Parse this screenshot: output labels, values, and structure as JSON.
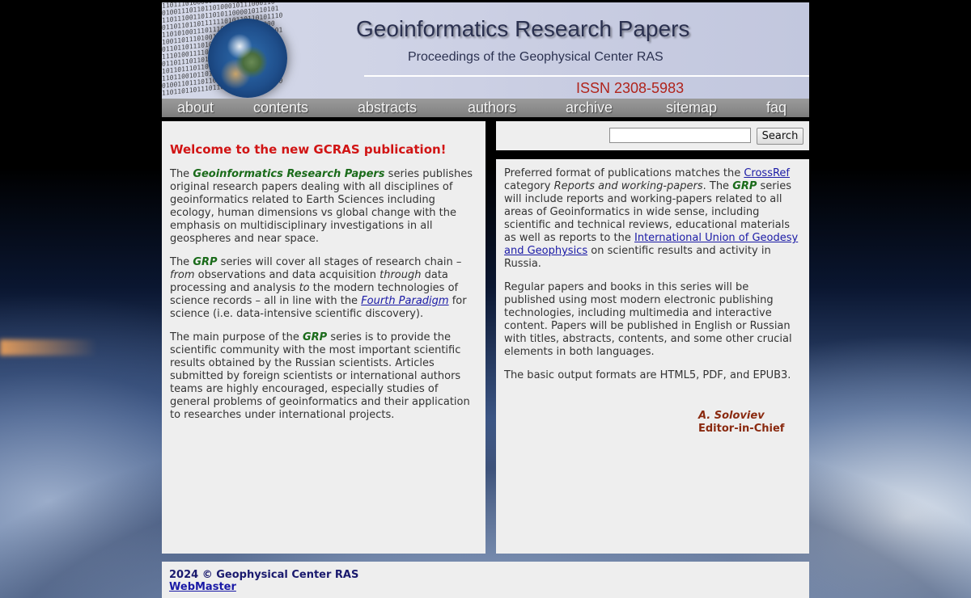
{
  "header": {
    "title": "Geoinformatics Research Papers",
    "subtitle": "Proceedings of the Geophysical Center RAS",
    "issn": "ISSN 2308-5983"
  },
  "nav": {
    "about": "about",
    "contents": "contents",
    "abstracts": "abstracts",
    "authors": "authors",
    "archive": "archive",
    "sitemap": "sitemap",
    "faq": "faq"
  },
  "search": {
    "value": "",
    "button": "Search"
  },
  "left": {
    "welcome": "Welcome to the new GCRAS publication!",
    "p1": {
      "pre": "The ",
      "series": "Geoinformatics Research Papers",
      "post": " series publishes original research papers dealing with all disciplines of geoinformatics related to Earth Sciences including ecology, human dimensions vs global change with the emphasis on multidisciplinary investigations in all geospheres and near space."
    },
    "p2": {
      "pre": "The ",
      "grp": "GRP",
      "mid1": " series will cover all stages of research chain – ",
      "from": "from",
      "mid2": " observations and data acquisition ",
      "through": "through",
      "mid3": " data processing and analysis ",
      "to": "to",
      "mid4": " the modern technologies of science records – all in line with the ",
      "link": "Fourth Paradigm",
      "post": " for science (i.e. data-intensive scientific discovery)."
    },
    "p3": {
      "pre": "The main purpose of the ",
      "grp": "GRP",
      "post": " series is to provide the scientific community with the most important scientific results obtained by the Russian scientists. Articles submitted by foreign scientists or international authors teams are highly encouraged, especially studies of general problems of geoinformatics and their application to researches under international projects."
    }
  },
  "right": {
    "p1": {
      "pre": "Preferred format of publications matches the ",
      "crossref": "CrossRef",
      "mid1": " category ",
      "category": "Reports and working-papers",
      "mid2": ". The ",
      "grp": "GRP",
      "mid3": " series will include reports and working-papers related to all areas of Geoinformatics in wide sense, including scientific and technical reviews, educational materials as well as reports to the ",
      "iugg": "International Union of Geodesy and Geophysics",
      "post": " on scientific results and activity in Russia."
    },
    "p2": "Regular papers and books in this series will be published using most modern electronic publishing technologies, including multimedia and interactive content. Papers will be published in English or Russian with titles, abstracts, contents, and some other crucial elements in both languages.",
    "p3": "The basic output formats are HTML5, PDF, and EPUB3.",
    "signature": {
      "name": "A. Soloviev",
      "role": "Editor-in-Chief"
    }
  },
  "footer": {
    "copyright": "2024 © Geophysical Center RAS",
    "webmaster": "WebMaster"
  }
}
